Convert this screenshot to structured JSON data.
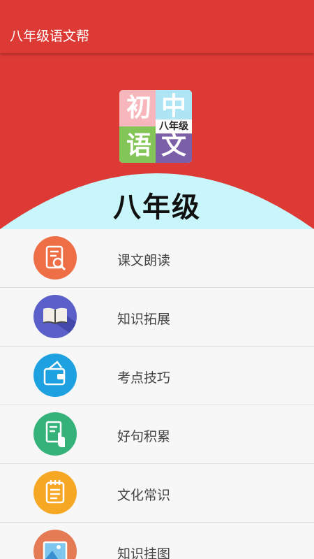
{
  "app": {
    "title": "八年级语文帮"
  },
  "banner": {
    "logo_chars": [
      "初",
      "中",
      "语",
      "文"
    ],
    "logo_badge": "八年级",
    "grade_title": "八年级"
  },
  "menu": {
    "items": [
      {
        "label": "课文朗读",
        "icon": "document-search-icon",
        "color": "#ee6e46"
      },
      {
        "label": "知识拓展",
        "icon": "open-book-icon",
        "color": "#5b5fc9"
      },
      {
        "label": "考点技巧",
        "icon": "wallet-icon",
        "color": "#1ea1e0"
      },
      {
        "label": "好句积累",
        "icon": "note-pointer-icon",
        "color": "#34b27a"
      },
      {
        "label": "文化常识",
        "icon": "notepad-icon",
        "color": "#f6a724"
      },
      {
        "label": "知识挂图",
        "icon": "picture-icon",
        "color": "#e57b54"
      }
    ]
  },
  "colors": {
    "appbar": "#dd3a35",
    "banner_curve": "#c9f6fa"
  }
}
